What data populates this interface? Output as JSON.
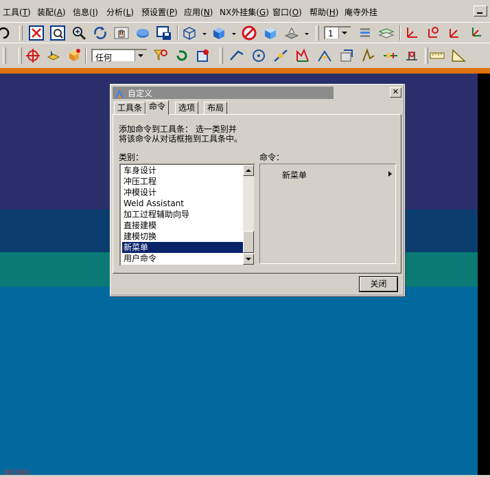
{
  "menubar": {
    "items": [
      {
        "label": "工具(",
        "key": "T",
        "suffix": ")"
      },
      {
        "label": "装配(",
        "key": "A",
        "suffix": ")"
      },
      {
        "label": "信息(",
        "key": "I",
        "suffix": ")"
      },
      {
        "label": "分析(",
        "key": "L",
        "suffix": ")"
      },
      {
        "label": "预设置(",
        "key": "P",
        "suffix": ")"
      },
      {
        "label": "应用(",
        "key": "N",
        "suffix": ")"
      },
      {
        "label": "NX外挂集(",
        "key": "G",
        "suffix": ")"
      },
      {
        "label": "窗口(",
        "key": "O",
        "suffix": ")"
      },
      {
        "label": "帮助(",
        "key": "H",
        "suffix": ")"
      },
      {
        "label": "庵寺外挂",
        "key": "",
        "suffix": ""
      }
    ]
  },
  "toolbar1": {
    "layer_combo_value": "1"
  },
  "toolbar2": {
    "filter_combo_value": "任何"
  },
  "viewport": {
    "work_label": "WORK"
  },
  "colors": {
    "selection": "#0a246a",
    "viewport_blue": "#02699e",
    "accent_orange": "#e07010"
  },
  "dialog": {
    "title": "自定义",
    "close_glyph": "✕",
    "tabs": [
      "工具条",
      "命令",
      "选项",
      "布局"
    ],
    "active_tab": "命令",
    "description_line1": "添加命令到工具条： 选一类别并",
    "description_line2": "将该命令从对话框拖到工具条中。",
    "category_label": "类别：",
    "command_label": "命令：",
    "categories": [
      "车身设计",
      "冲压工程",
      "冲模设计",
      "Weld Assistant",
      "加工过程辅助向导",
      "直接建模",
      "建模切换",
      "新菜单",
      "用户命令"
    ],
    "selected_category": "新菜单",
    "commands": [
      "新菜单"
    ],
    "close_button": "关闭"
  }
}
